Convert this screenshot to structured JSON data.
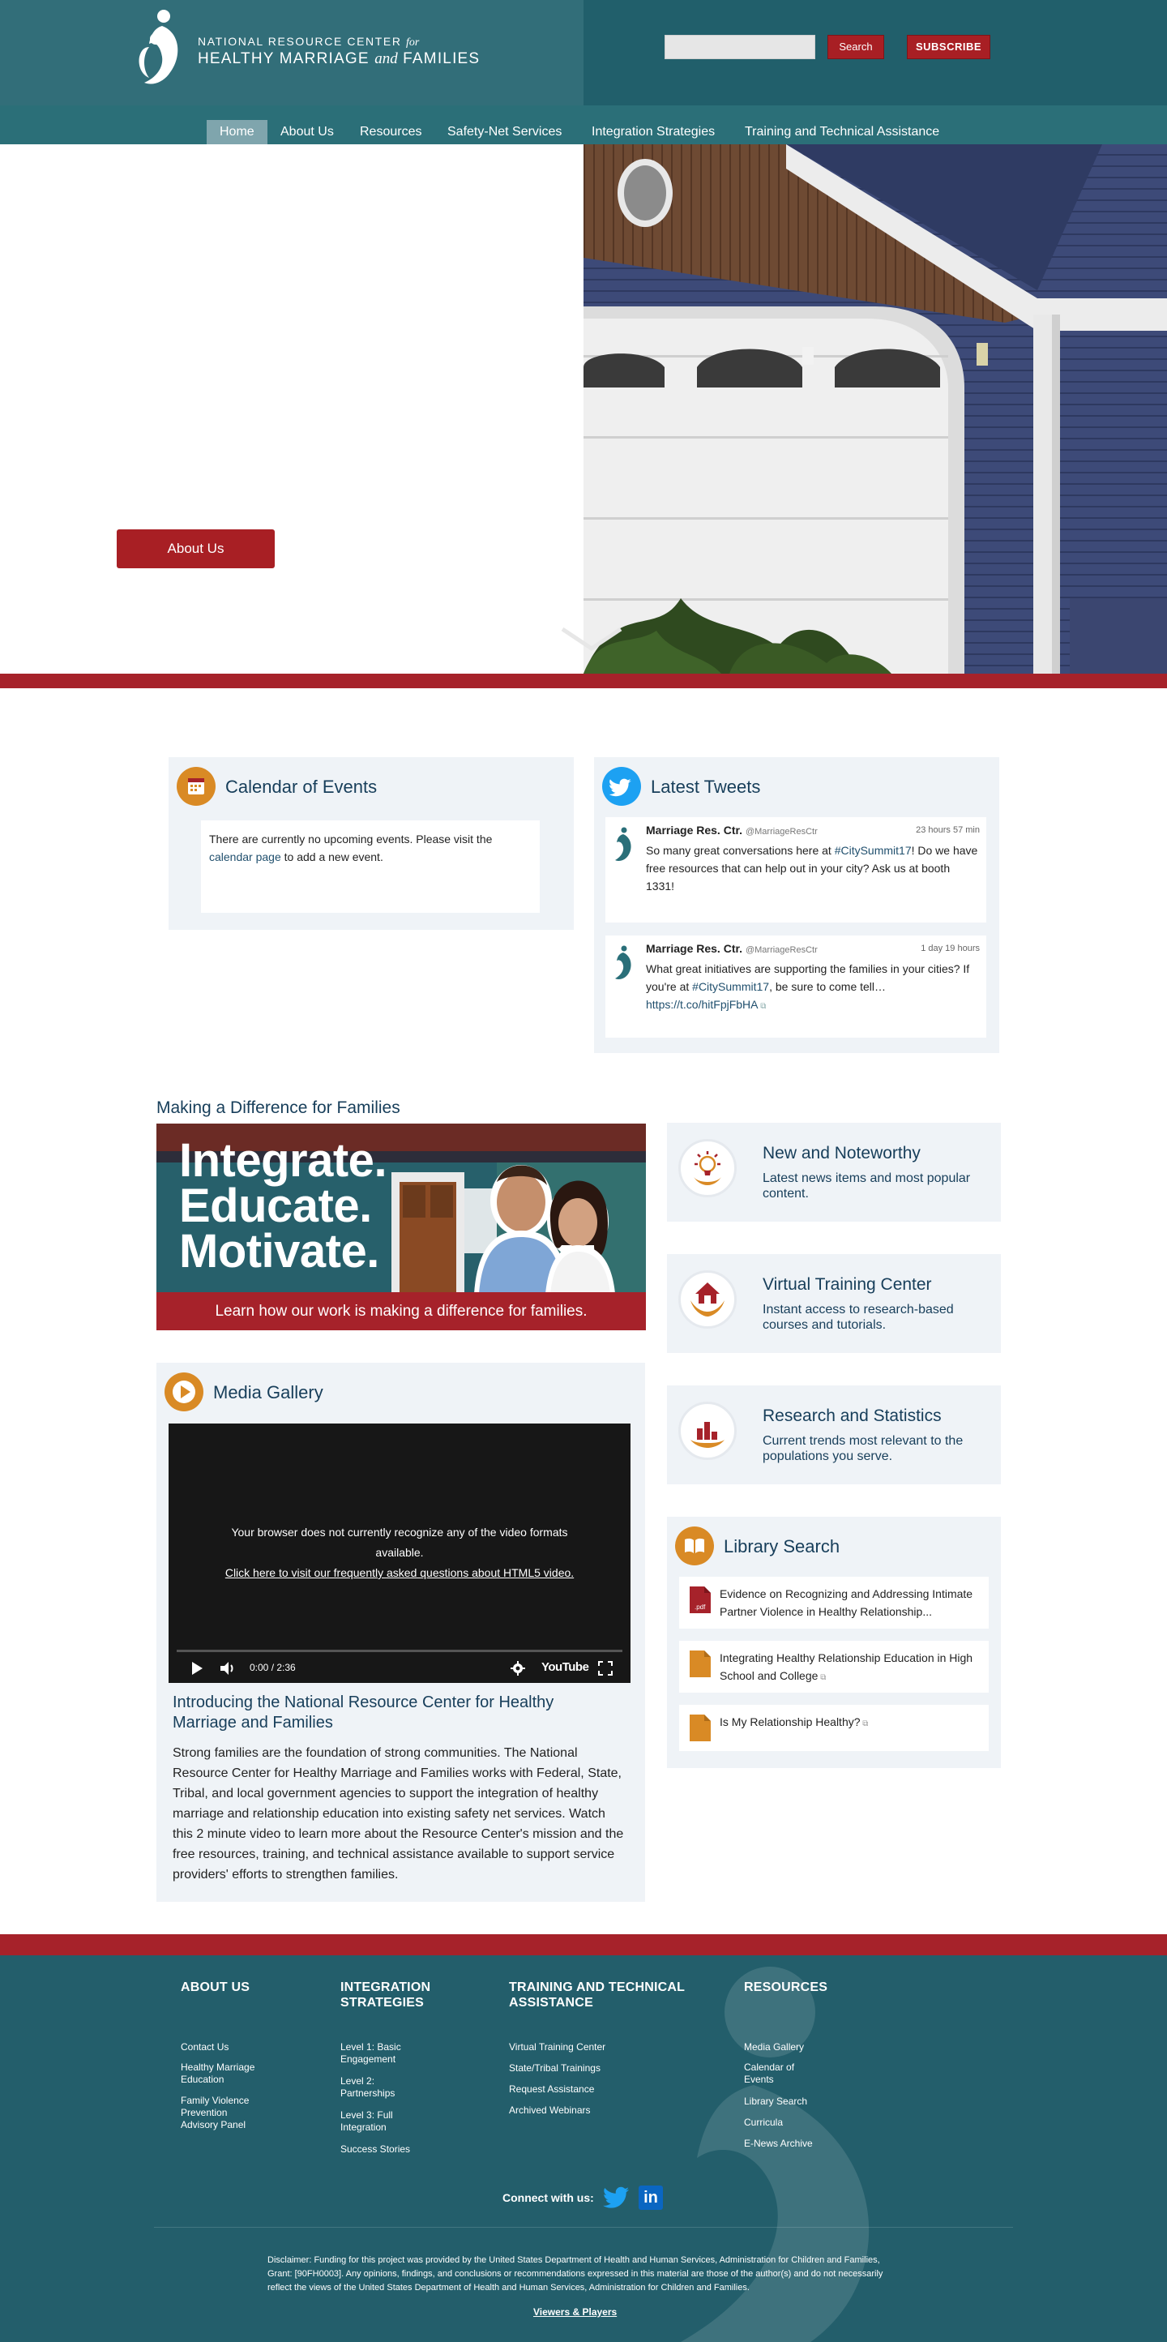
{
  "header": {
    "logo_line1_a": "NATIONAL RESOURCE CENTER ",
    "logo_line1_b": "for",
    "logo_line2_a": "HEALTHY MARRIAGE ",
    "logo_line2_b": "and",
    "logo_line2_c": " FAMILIES",
    "search_placeholder": "",
    "search_button": "Search",
    "subscribe_button": "SUBSCRIBE"
  },
  "nav": {
    "items": [
      "Home",
      "About Us",
      "Resources",
      "Safety-Net Services",
      "Integration Strategies",
      "Training and Technical Assistance"
    ],
    "active_index": 0
  },
  "hero": {
    "button_label": "About Us"
  },
  "calendar": {
    "title": "Calendar of Events",
    "text_before": "There are currently no upcoming events. Please visit the ",
    "link": "calendar page",
    "text_after": " to add a new event."
  },
  "tweets": {
    "title": "Latest Tweets",
    "items": [
      {
        "name": "Marriage Res. Ctr.",
        "handle": "@MarriageResCtr",
        "time": "23 hours 57 min",
        "text_a": "So many great conversations here at ",
        "hashtag": "#CitySummit17",
        "text_b": "! Do we have free resources that can help out in your city? Ask us at booth 1331!"
      },
      {
        "name": "Marriage Res. Ctr.",
        "handle": "@MarriageResCtr",
        "time": "1 day 19 hours",
        "text_a": "What great initiatives are supporting the families in your cities? If you're at ",
        "hashtag": "#CitySummit17",
        "text_b": ", be sure to come tell…",
        "link": "https://t.co/hitFpjFbHA"
      }
    ]
  },
  "making_difference": {
    "heading": "Making a Difference for Families",
    "banner_lines": [
      "Integrate.",
      "Educate.",
      "Motivate."
    ],
    "banner_caption": "Learn how our work is making a difference for families."
  },
  "tiles": [
    {
      "title": "New and Noteworthy",
      "desc": "Latest news items and most popular content."
    },
    {
      "title": "Virtual Training Center",
      "desc": "Instant access to research-based courses and tutorials."
    },
    {
      "title": "Research and Statistics",
      "desc": "Current trends most relevant to the populations you serve."
    }
  ],
  "media": {
    "title": "Media Gallery",
    "video_msg_line1": "Your browser does not currently recognize any of the video formats",
    "video_msg_line2": "available.",
    "video_msg_link": "Click here to visit our frequently asked questions about HTML5 video.",
    "video_time": "0:00 / 2:36",
    "video_brand": "YouTube",
    "progress": 0,
    "video_title": "Introducing the National Resource Center for Healthy Marriage and Families",
    "video_desc": "Strong families are the foundation of strong communities. The National Resource Center for Healthy Marriage and Families works with Federal, State, Tribal, and local government agencies to support the integration of healthy marriage and relationship education into existing safety net services. Watch this 2 minute video to learn more about the Resource Center's mission and the free resources, training, and technical assistance available to support service providers' efforts to strengthen families."
  },
  "library": {
    "title": "Library Search",
    "items": [
      {
        "text": "Evidence on Recognizing and Addressing Intimate Partner Violence in Healthy Relationship...",
        "type": "pdf"
      },
      {
        "text": "Integrating Healthy Relationship Education in High School and College",
        "type": "doc"
      },
      {
        "text": "Is My Relationship Healthy?",
        "type": "doc"
      }
    ]
  },
  "footer": {
    "columns": [
      {
        "heading": "ABOUT US",
        "links": [
          "Contact Us",
          "Healthy Marriage Education",
          "Family Violence Prevention Advisory Panel"
        ]
      },
      {
        "heading": "INTEGRATION STRATEGIES",
        "links": [
          "Level 1: Basic Engagement",
          "Level 2: Partnerships",
          "Level 3: Full Integration",
          "Success Stories"
        ]
      },
      {
        "heading": "TRAINING AND TECHNICAL ASSISTANCE",
        "links": [
          "Virtual Training Center",
          "State/Tribal Trainings",
          "Request Assistance",
          "Archived Webinars"
        ]
      },
      {
        "heading": "RESOURCES",
        "links": [
          "Media Gallery",
          "Calendar of Events",
          "Library Search",
          "Curricula",
          "E-News Archive"
        ]
      }
    ],
    "connect_label": "Connect with us:",
    "linkedin_label": "in",
    "disclaimer": "Disclaimer: Funding for this project was provided by the United States Department of Health and Human Services, Administration for Children and Families, Grant: [90FH0003]. Any opinions, findings, and conclusions or recommendations expressed in this material are those of the author(s) and do not necessarily reflect the views of the United States Department of Health and Human Services, Administration for Children and Families.",
    "viewers_link": "Viewers & Players"
  },
  "colors": {
    "header_teal": "#326e79",
    "brand_red": "#a6222a",
    "panel_bg": "#eff3f7",
    "heading_navy": "#173e5a",
    "icon_orange": "#d98a25",
    "twitter_blue": "#1da1f2"
  }
}
